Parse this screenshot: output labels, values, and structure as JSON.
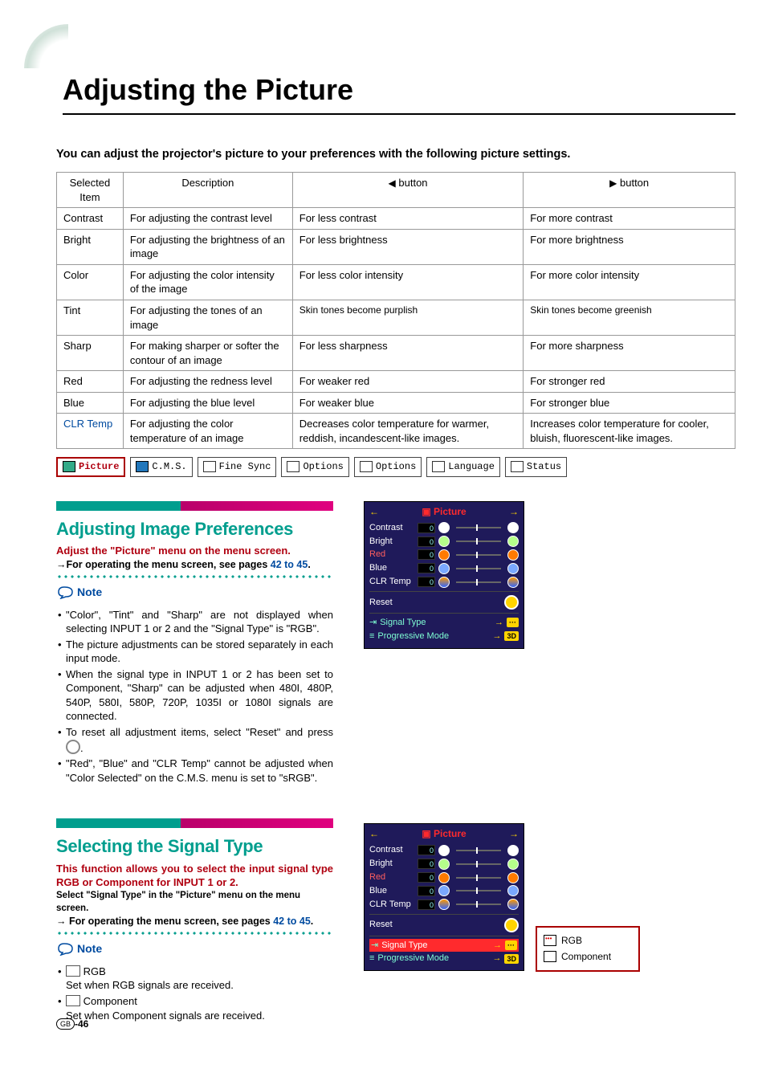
{
  "page_title": "Adjusting the Picture",
  "intro": "You can adjust the projector's picture to your preferences with the following picture settings.",
  "table": {
    "headers": {
      "item": "Selected Item",
      "desc": "Description",
      "left": "button",
      "right": "button"
    },
    "rows": [
      {
        "item": "Contrast",
        "desc": "For adjusting the contrast level",
        "left": "For less contrast",
        "right": "For more contrast"
      },
      {
        "item": "Bright",
        "desc": "For adjusting the brightness of an image",
        "left": "For less brightness",
        "right": "For more brightness"
      },
      {
        "item": "Color",
        "desc": "For adjusting the color intensity of the image",
        "left": "For less color intensity",
        "right": "For more color intensity"
      },
      {
        "item": "Tint",
        "desc": "For adjusting the tones of an image",
        "left": "Skin tones become purplish",
        "right": "Skin tones become greenish"
      },
      {
        "item": "Sharp",
        "desc": "For making sharper or softer the contour of an image",
        "left": "For less sharpness",
        "right": "For more sharpness"
      },
      {
        "item": "Red",
        "desc": "For adjusting the redness level",
        "left": "For weaker red",
        "right": "For stronger red"
      },
      {
        "item": "Blue",
        "desc": "For adjusting the blue level",
        "left": "For weaker blue",
        "right": "For stronger blue"
      },
      {
        "item": "CLR Temp",
        "desc": "For adjusting the color temperature of an image",
        "left": "Decreases color temperature for warmer, reddish, incandescent-like images.",
        "right": "Increases color temperature for cooler, bluish, fluorescent-like images.",
        "link": true
      }
    ]
  },
  "menu_bar": [
    "Picture",
    "C.M.S.",
    "Fine Sync",
    "Options",
    "Options",
    "Language",
    "Status"
  ],
  "section1": {
    "heading": "Adjusting Image Preferences",
    "red_line": "Adjust the \"Picture\" menu on the menu screen.",
    "op_pre": "For operating the menu screen, see pages ",
    "op_link": "42 to 45",
    "note_label": "Note",
    "bullets": [
      "\"Color\", \"Tint\" and \"Sharp\" are not displayed when selecting INPUT 1 or 2 and the \"Signal Type\" is \"RGB\".",
      "The picture adjustments can be stored separately in each input mode.",
      "When the signal type in INPUT 1 or 2 has been set to Component, \"Sharp\" can be adjusted when 480I, 480P, 540P, 580I, 580P, 720P, 1035I or 1080I signals are connected.",
      "To reset all adjustment items, select \"Reset\" and press ⊚.",
      "\"Red\", \"Blue\" and \"CLR Temp\" cannot be adjusted when \"Color Selected\" on the C.M.S. menu is set to \"sRGB\"."
    ]
  },
  "section2": {
    "heading": "Selecting the Signal Type",
    "red_line": "This function allows you to select the input signal type RGB or Component for INPUT 1 or 2.",
    "bold_line": "Select \"Signal Type\" in the \"Picture\" menu on the menu screen.",
    "op_pre": "For operating the menu screen, see pages ",
    "op_link": "42 to 45",
    "note_label": "Note",
    "bullets_html": [
      {
        "icon": "rgb",
        "title": "RGB",
        "line": "Set when RGB signals are received."
      },
      {
        "icon": "comp",
        "title": "Component",
        "line": "Set when Component signals are received."
      }
    ]
  },
  "osd": {
    "title": "Picture",
    "rows": [
      {
        "label": "Contrast",
        "val": "0",
        "orb": "wt"
      },
      {
        "label": "Bright",
        "val": "0",
        "orb": "lg"
      },
      {
        "label": "Red",
        "val": "0",
        "orb": "rd",
        "red": true
      },
      {
        "label": "Blue",
        "val": "0",
        "orb": "bl"
      },
      {
        "label": "CLR Temp",
        "val": "0",
        "orb": "tmp"
      }
    ],
    "reset": "Reset",
    "signal_type": "Signal Type",
    "prog_mode": "Progressive Mode",
    "prog_tag": "3D"
  },
  "submenu": {
    "rgb": "RGB",
    "component": "Component"
  },
  "footer": {
    "region": "GB",
    "page": "-46"
  }
}
